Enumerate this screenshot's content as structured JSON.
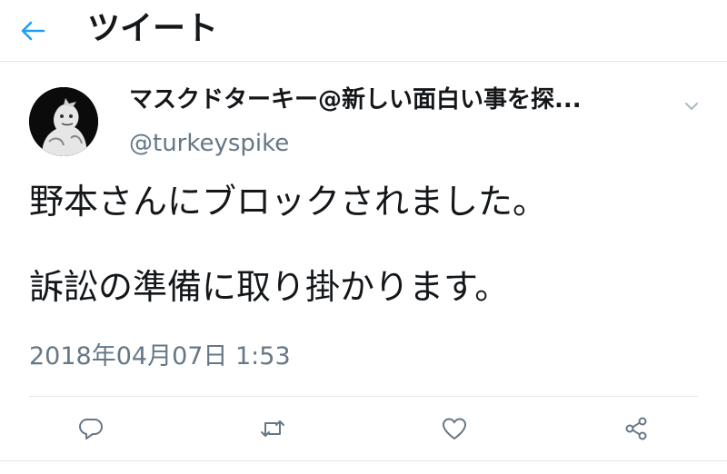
{
  "header": {
    "back_icon": "arrow-left-icon",
    "title": "ツイート"
  },
  "tweet": {
    "display_name": "マスクドターキー@新しい面白い事を探...",
    "username": "@turkeyspike",
    "text_line1": "野本さんにブロックされました。",
    "text_line2": "訴訟の準備に取り掛かります。",
    "timestamp": "2018年04月07日 1:53"
  },
  "actions": {
    "reply_icon": "reply-icon",
    "retweet_icon": "retweet-icon",
    "like_icon": "heart-icon",
    "share_icon": "share-icon"
  },
  "colors": {
    "accent": "#1da1f2",
    "secondary_text": "#657786",
    "icon_gray": "#657786",
    "divider": "#e1e8ed"
  }
}
